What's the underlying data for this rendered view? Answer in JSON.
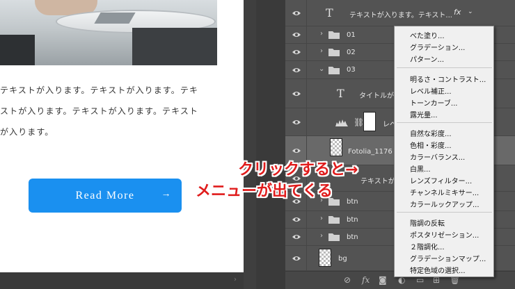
{
  "canvas": {
    "body_lines": [
      "テキストが入ります。テキストが入ります。テキ",
      "ストが入ります。テキストが入ります。テキスト",
      "が入ります。"
    ],
    "button_label": "Read More",
    "button_arrow": "→",
    "accent_color": "#1a90f0"
  },
  "layers": [
    {
      "type": "text",
      "name": "テキストが入ります。テキスト...",
      "fx": "fx"
    },
    {
      "type": "folder",
      "name": "01",
      "expanded": false
    },
    {
      "type": "folder",
      "name": "02",
      "expanded": false
    },
    {
      "type": "folder",
      "name": "03",
      "expanded": true
    },
    {
      "type": "text",
      "name": "タイトルが入..."
    },
    {
      "type": "adjustment",
      "name": "レベ"
    },
    {
      "type": "image",
      "name": "Fotolia_1176",
      "selected": true
    },
    {
      "type": "text",
      "name": "テキストが入"
    },
    {
      "type": "folder",
      "name": "btn",
      "expanded": false
    },
    {
      "type": "folder",
      "name": "btn",
      "expanded": false
    },
    {
      "type": "folder",
      "name": "btn",
      "expanded": false
    },
    {
      "type": "image",
      "name": "bg"
    }
  ],
  "footer_icons": [
    "link-icon",
    "fx-icon",
    "mask-icon",
    "adjustment-icon",
    "folder-icon",
    "new-layer-icon",
    "trash-icon"
  ],
  "footer_fx": "fx",
  "menu": {
    "groups": [
      [
        "べた塗り...",
        "グラデーション...",
        "パターン..."
      ],
      [
        "明るさ・コントラスト...",
        "レベル補正...",
        "トーンカーブ...",
        "露光量..."
      ],
      [
        "自然な彩度...",
        "色相・彩度...",
        "カラーバランス...",
        "白黒...",
        "レンズフィルター...",
        "チャンネルミキサー...",
        "カラールックアップ..."
      ],
      [
        "階調の反転",
        "ポスタリゼーション...",
        "２階調化...",
        "グラデーションマップ...",
        "特定色域の選択..."
      ]
    ]
  },
  "annotation": {
    "line1": "クリックすると→",
    "line2": "メニューが出てくる",
    "color": "#e01c1c"
  }
}
